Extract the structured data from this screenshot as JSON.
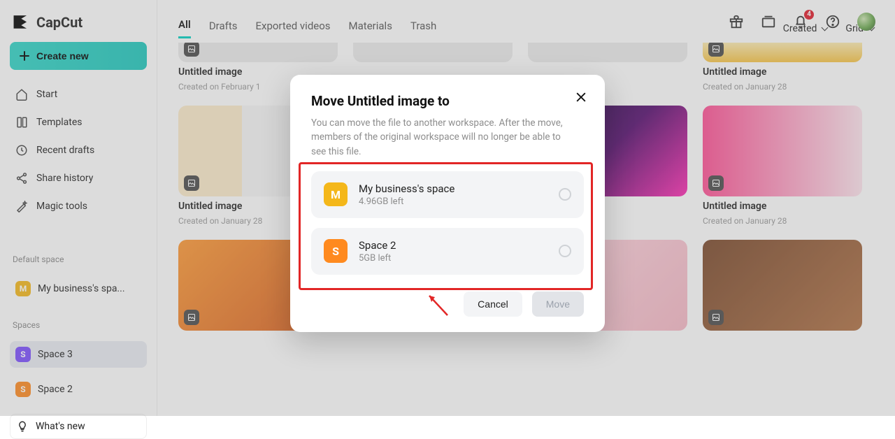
{
  "brand": {
    "name": "CapCut"
  },
  "create_label": "Create new",
  "nav": {
    "start": "Start",
    "templates": "Templates",
    "recent_drafts": "Recent drafts",
    "share_history": "Share history",
    "magic_tools": "Magic tools"
  },
  "sections": {
    "default_space_label": "Default space",
    "spaces_label": "Spaces",
    "whats_new": "What's new"
  },
  "default_space": {
    "initial": "M",
    "name": "My business's spa..."
  },
  "spaces": [
    {
      "initial": "S",
      "name": "Space 3"
    },
    {
      "initial": "S",
      "name": "Space 2"
    }
  ],
  "tabs": {
    "items": [
      "All",
      "Drafts",
      "Exported videos",
      "Materials",
      "Trash"
    ],
    "sort_label": "Created",
    "view_label": "Grid"
  },
  "topbar": {
    "notification_count": "4"
  },
  "cards": {
    "row0": [
      {
        "title": "Untitled image",
        "sub": "Created on February 1"
      },
      {
        "title": "",
        "sub": ""
      },
      {
        "title": "",
        "sub": ""
      },
      {
        "title": "Untitled image",
        "sub": "Created on January 28"
      }
    ],
    "row1": [
      {
        "title": "Untitled image",
        "sub": "Created on January 28"
      },
      {
        "title": "",
        "sub": ""
      },
      {
        "title": "",
        "sub": ""
      },
      {
        "title": "Untitled image",
        "sub": "Created on January 28"
      }
    ]
  },
  "modal": {
    "title": "Move Untitled image to",
    "desc": "You can move the file to another workspace. After the move, members of the original workspace will no longer be able to see this file.",
    "destinations": [
      {
        "initial": "M",
        "name": "My business's space",
        "left": "4.96GB left",
        "color": "yellow"
      },
      {
        "initial": "S",
        "name": "Space 2",
        "left": "5GB left",
        "color": "orange"
      }
    ],
    "cancel": "Cancel",
    "move": "Move"
  }
}
